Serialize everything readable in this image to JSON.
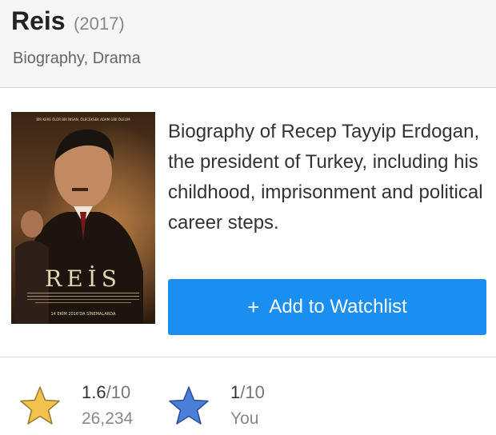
{
  "header": {
    "title": "Reis",
    "year": "(2017)",
    "genres": "Biography, Drama"
  },
  "poster": {
    "tagline": "BİR KERE ÖLÜR BİR İNSAN, ÖLECEKSEK ADAM GİBİ ÖLELİM",
    "title_text": "REİS",
    "release_text": "14 EKİM 2016'DA SİNEMALARDA"
  },
  "plot": "Biography of Recep Tayyip Erdogan, the president of Turkey, including his childhood, imprisonment and political career steps.",
  "watchlist": {
    "icon": "plus-icon",
    "label": "Add to Watchlist"
  },
  "ratings": {
    "imdb": {
      "score": "1.6",
      "denom": "/10",
      "count": "26,234",
      "icon": "star-icon",
      "color": "#f2c14e"
    },
    "user": {
      "score": "1",
      "denom": "/10",
      "label": "You",
      "icon": "star-icon",
      "color": "#4a7fd8"
    }
  },
  "colors": {
    "accent": "#1b8ef2",
    "header_bg": "#f6f6f6"
  }
}
